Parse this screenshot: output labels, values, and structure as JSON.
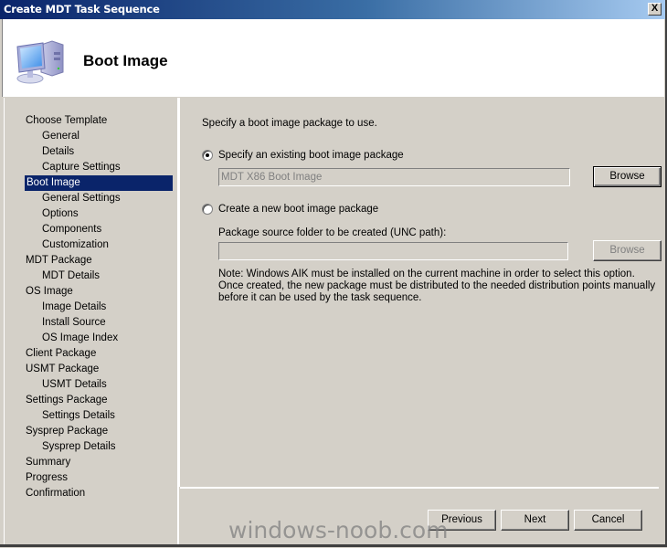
{
  "window": {
    "title": "Create MDT Task Sequence",
    "close_label": "X"
  },
  "header": {
    "icon": "computer-icon",
    "title": "Boot Image"
  },
  "sidebar": {
    "items": [
      {
        "label": "Choose Template",
        "level": 0,
        "active": false
      },
      {
        "label": "General",
        "level": 1,
        "active": false
      },
      {
        "label": "Details",
        "level": 1,
        "active": false
      },
      {
        "label": "Capture Settings",
        "level": 1,
        "active": false
      },
      {
        "label": "Boot Image",
        "level": 0,
        "active": true
      },
      {
        "label": "General Settings",
        "level": 1,
        "active": false
      },
      {
        "label": "Options",
        "level": 1,
        "active": false
      },
      {
        "label": "Components",
        "level": 1,
        "active": false
      },
      {
        "label": "Customization",
        "level": 1,
        "active": false
      },
      {
        "label": "MDT Package",
        "level": 0,
        "active": false
      },
      {
        "label": "MDT Details",
        "level": 1,
        "active": false
      },
      {
        "label": "OS Image",
        "level": 0,
        "active": false
      },
      {
        "label": "Image Details",
        "level": 1,
        "active": false
      },
      {
        "label": "Install Source",
        "level": 1,
        "active": false
      },
      {
        "label": "OS Image Index",
        "level": 1,
        "active": false
      },
      {
        "label": "Client Package",
        "level": 0,
        "active": false
      },
      {
        "label": "USMT Package",
        "level": 0,
        "active": false
      },
      {
        "label": "USMT Details",
        "level": 1,
        "active": false
      },
      {
        "label": "Settings Package",
        "level": 0,
        "active": false
      },
      {
        "label": "Settings Details",
        "level": 1,
        "active": false
      },
      {
        "label": "Sysprep Package",
        "level": 0,
        "active": false
      },
      {
        "label": "Sysprep Details",
        "level": 1,
        "active": false
      },
      {
        "label": "Summary",
        "level": 0,
        "active": false
      },
      {
        "label": "Progress",
        "level": 0,
        "active": false
      },
      {
        "label": "Confirmation",
        "level": 0,
        "active": false
      }
    ]
  },
  "main": {
    "intro": "Specify a boot image package to use.",
    "option_existing": {
      "label": "Specify an existing boot image package",
      "checked": true,
      "value": "MDT X86 Boot Image",
      "browse_label": "Browse"
    },
    "option_new": {
      "label": "Create a new boot image package",
      "checked": false,
      "field_label": "Package source folder to be created (UNC path):",
      "value": "",
      "browse_label": "Browse"
    },
    "note": "Note: Windows AIK must be installed on the current machine in order to select this option.  Once created, the new package must be distributed to the needed distribution points manually before it can be used by the task sequence."
  },
  "footer": {
    "previous_label": "Previous",
    "next_label": "Next",
    "cancel_label": "Cancel"
  },
  "watermark": "windows-noob.com"
}
